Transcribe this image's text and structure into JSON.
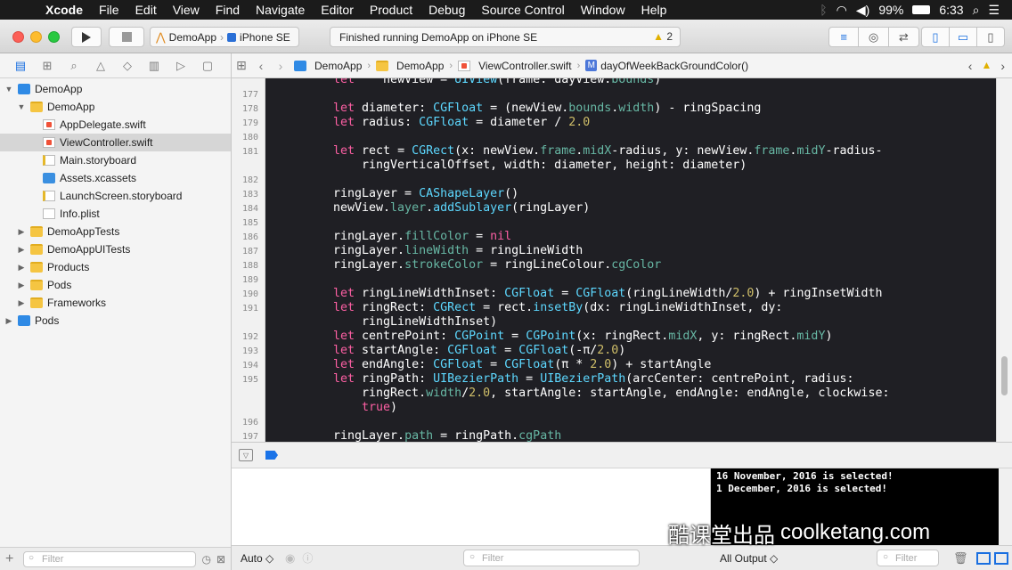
{
  "menubar": {
    "app": "Xcode",
    "items": [
      "File",
      "Edit",
      "View",
      "Find",
      "Navigate",
      "Editor",
      "Product",
      "Debug",
      "Source Control",
      "Window",
      "Help"
    ],
    "battery": "99%",
    "time": "6:33"
  },
  "toolbar": {
    "scheme_app": "DemoApp",
    "scheme_device": "iPhone SE",
    "activity_text": "Finished running DemoApp on iPhone SE",
    "warning_count": "2"
  },
  "navigator": {
    "tree": [
      {
        "label": "DemoApp",
        "icon": "project-icon",
        "depth": 0,
        "disclosure": "open"
      },
      {
        "label": "DemoApp",
        "icon": "folder-icon",
        "depth": 1,
        "disclosure": "open"
      },
      {
        "label": "AppDelegate.swift",
        "icon": "swift-file-icon",
        "depth": 2,
        "disclosure": ""
      },
      {
        "label": "ViewController.swift",
        "icon": "swift-file-icon",
        "depth": 2,
        "disclosure": "",
        "selected": true
      },
      {
        "label": "Main.storyboard",
        "icon": "storyboard-icon",
        "depth": 2,
        "disclosure": ""
      },
      {
        "label": "Assets.xcassets",
        "icon": "assets-icon",
        "depth": 2,
        "disclosure": ""
      },
      {
        "label": "LaunchScreen.storyboard",
        "icon": "storyboard-icon",
        "depth": 2,
        "disclosure": ""
      },
      {
        "label": "Info.plist",
        "icon": "plist-icon",
        "depth": 2,
        "disclosure": ""
      },
      {
        "label": "DemoAppTests",
        "icon": "folder-icon",
        "depth": 1,
        "disclosure": "closed"
      },
      {
        "label": "DemoAppUITests",
        "icon": "folder-icon",
        "depth": 1,
        "disclosure": "closed"
      },
      {
        "label": "Products",
        "icon": "folder-icon",
        "depth": 1,
        "disclosure": "closed"
      },
      {
        "label": "Pods",
        "icon": "folder-icon",
        "depth": 1,
        "disclosure": "closed"
      },
      {
        "label": "Frameworks",
        "icon": "folder-icon",
        "depth": 1,
        "disclosure": "closed"
      },
      {
        "label": "Pods",
        "icon": "project-icon",
        "depth": 0,
        "disclosure": "closed"
      }
    ],
    "filter_placeholder": "Filter"
  },
  "jumpbar": {
    "crumbs": [
      "DemoApp",
      "DemoApp",
      "ViewController.swift",
      "dayOfWeekBackGroundColor()"
    ],
    "method_badge": "M"
  },
  "editor": {
    "lines": [
      {
        "n": "",
        "tokens": [
          [
            "kw",
            "let"
          ],
          [
            "",
            "    newView = "
          ],
          [
            "ty",
            "UIView"
          ],
          [
            "",
            "(frame: dayView."
          ],
          [
            "pr",
            "bounds"
          ],
          [
            "",
            ")"
          ]
        ],
        "indent": 0,
        "partial": true
      },
      {
        "n": "177",
        "tokens": []
      },
      {
        "n": "178",
        "tokens": [
          [
            "kw",
            "let"
          ],
          [
            "",
            " diameter: "
          ],
          [
            "ty",
            "CGFloat"
          ],
          [
            "",
            " = (newView."
          ],
          [
            "pr",
            "bounds"
          ],
          [
            "",
            "."
          ],
          [
            "pr",
            "width"
          ],
          [
            "",
            ") - ringSpacing"
          ]
        ]
      },
      {
        "n": "179",
        "tokens": [
          [
            "kw",
            "let"
          ],
          [
            "",
            " radius: "
          ],
          [
            "ty",
            "CGFloat"
          ],
          [
            "",
            " = diameter / "
          ],
          [
            "nu",
            "2.0"
          ]
        ]
      },
      {
        "n": "180",
        "tokens": []
      },
      {
        "n": "181",
        "tokens": [
          [
            "kw",
            "let"
          ],
          [
            "",
            " rect = "
          ],
          [
            "ty",
            "CGRect"
          ],
          [
            "",
            "(x: newView."
          ],
          [
            "pr",
            "frame"
          ],
          [
            "",
            "."
          ],
          [
            "pr",
            "midX"
          ],
          [
            "",
            "-radius, y: newView."
          ],
          [
            "pr",
            "frame"
          ],
          [
            "",
            "."
          ],
          [
            "pr",
            "midY"
          ],
          [
            "",
            "-radius-"
          ]
        ]
      },
      {
        "n": "",
        "tokens": [
          [
            "",
            "    ringVerticalOffset, width: diameter, height: diameter)"
          ]
        ]
      },
      {
        "n": "182",
        "tokens": []
      },
      {
        "n": "183",
        "tokens": [
          [
            "",
            "ringLayer = "
          ],
          [
            "ty",
            "CAShapeLayer"
          ],
          [
            "",
            "()"
          ]
        ]
      },
      {
        "n": "184",
        "tokens": [
          [
            "",
            "newView."
          ],
          [
            "pr",
            "layer"
          ],
          [
            "",
            "."
          ],
          [
            "fn",
            "addSublayer"
          ],
          [
            "",
            "(ringLayer)"
          ]
        ]
      },
      {
        "n": "185",
        "tokens": []
      },
      {
        "n": "186",
        "tokens": [
          [
            "",
            "ringLayer."
          ],
          [
            "pr",
            "fillColor"
          ],
          [
            "",
            " = "
          ],
          [
            "kw",
            "nil"
          ]
        ]
      },
      {
        "n": "187",
        "tokens": [
          [
            "",
            "ringLayer."
          ],
          [
            "pr",
            "lineWidth"
          ],
          [
            "",
            " = ringLineWidth"
          ]
        ]
      },
      {
        "n": "188",
        "tokens": [
          [
            "",
            "ringLayer."
          ],
          [
            "pr",
            "strokeColor"
          ],
          [
            "",
            " = ringLineColour."
          ],
          [
            "pr",
            "cgColor"
          ]
        ]
      },
      {
        "n": "189",
        "tokens": []
      },
      {
        "n": "190",
        "tokens": [
          [
            "kw",
            "let"
          ],
          [
            "",
            " ringLineWidthInset: "
          ],
          [
            "ty",
            "CGFloat"
          ],
          [
            "",
            " = "
          ],
          [
            "ty",
            "CGFloat"
          ],
          [
            "",
            "(ringLineWidth/"
          ],
          [
            "nu",
            "2.0"
          ],
          [
            "",
            ") + ringInsetWidth"
          ]
        ]
      },
      {
        "n": "191",
        "tokens": [
          [
            "kw",
            "let"
          ],
          [
            "",
            " ringRect: "
          ],
          [
            "ty",
            "CGRect"
          ],
          [
            "",
            " = rect."
          ],
          [
            "fn",
            "insetBy"
          ],
          [
            "",
            "(dx: ringLineWidthInset, dy:"
          ]
        ]
      },
      {
        "n": "",
        "tokens": [
          [
            "",
            "    ringLineWidthInset)"
          ]
        ]
      },
      {
        "n": "192",
        "tokens": [
          [
            "kw",
            "let"
          ],
          [
            "",
            " centrePoint: "
          ],
          [
            "ty",
            "CGPoint"
          ],
          [
            "",
            " = "
          ],
          [
            "ty",
            "CGPoint"
          ],
          [
            "",
            "(x: ringRect."
          ],
          [
            "pr",
            "midX"
          ],
          [
            "",
            ", y: ringRect."
          ],
          [
            "pr",
            "midY"
          ],
          [
            "",
            ")"
          ]
        ]
      },
      {
        "n": "193",
        "tokens": [
          [
            "kw",
            "let"
          ],
          [
            "",
            " startAngle: "
          ],
          [
            "ty",
            "CGFloat"
          ],
          [
            "",
            " = "
          ],
          [
            "ty",
            "CGFloat"
          ],
          [
            "",
            "(-π/"
          ],
          [
            "nu",
            "2.0"
          ],
          [
            "",
            ")"
          ]
        ]
      },
      {
        "n": "194",
        "tokens": [
          [
            "kw",
            "let"
          ],
          [
            "",
            " endAngle: "
          ],
          [
            "ty",
            "CGFloat"
          ],
          [
            "",
            " = "
          ],
          [
            "ty",
            "CGFloat"
          ],
          [
            "",
            "(π * "
          ],
          [
            "nu",
            "2.0"
          ],
          [
            "",
            ") + startAngle"
          ]
        ]
      },
      {
        "n": "195",
        "tokens": [
          [
            "kw",
            "let"
          ],
          [
            "",
            " ringPath: "
          ],
          [
            "ty",
            "UIBezierPath"
          ],
          [
            "",
            " = "
          ],
          [
            "ty",
            "UIBezierPath"
          ],
          [
            "",
            "(arcCenter: centrePoint, radius:"
          ]
        ]
      },
      {
        "n": "",
        "tokens": [
          [
            "",
            "    ringRect."
          ],
          [
            "pr",
            "width"
          ],
          [
            "",
            "/"
          ],
          [
            "nu",
            "2.0"
          ],
          [
            "",
            ", startAngle: startAngle, endAngle: endAngle, clockwise:"
          ]
        ]
      },
      {
        "n": "",
        "tokens": [
          [
            "kw",
            "    true"
          ],
          [
            "",
            ")"
          ]
        ]
      },
      {
        "n": "196",
        "tokens": []
      },
      {
        "n": "197",
        "tokens": [
          [
            "",
            "ringLayer."
          ],
          [
            "pr",
            "path"
          ],
          [
            "",
            " = ringPath."
          ],
          [
            "pr",
            "cgPath"
          ]
        ]
      }
    ]
  },
  "console": {
    "lines": [
      "16 November, 2016 is selected!",
      "1 December, 2016 is selected!"
    ]
  },
  "bottombar": {
    "auto_label": "Auto ◇",
    "variables_filter": "Filter",
    "output_selector": "All Output ◇",
    "console_filter": "Filter"
  },
  "watermark": {
    "cn": "酷课堂出品",
    "url": "coolketang.com"
  },
  "colors": {
    "keyword": "#fc5fa3",
    "type": "#5dd8ff",
    "property": "#67b7a4",
    "number": "#d0bf69",
    "editor_bg": "#1f1f24",
    "accent": "#1a6fe0"
  }
}
